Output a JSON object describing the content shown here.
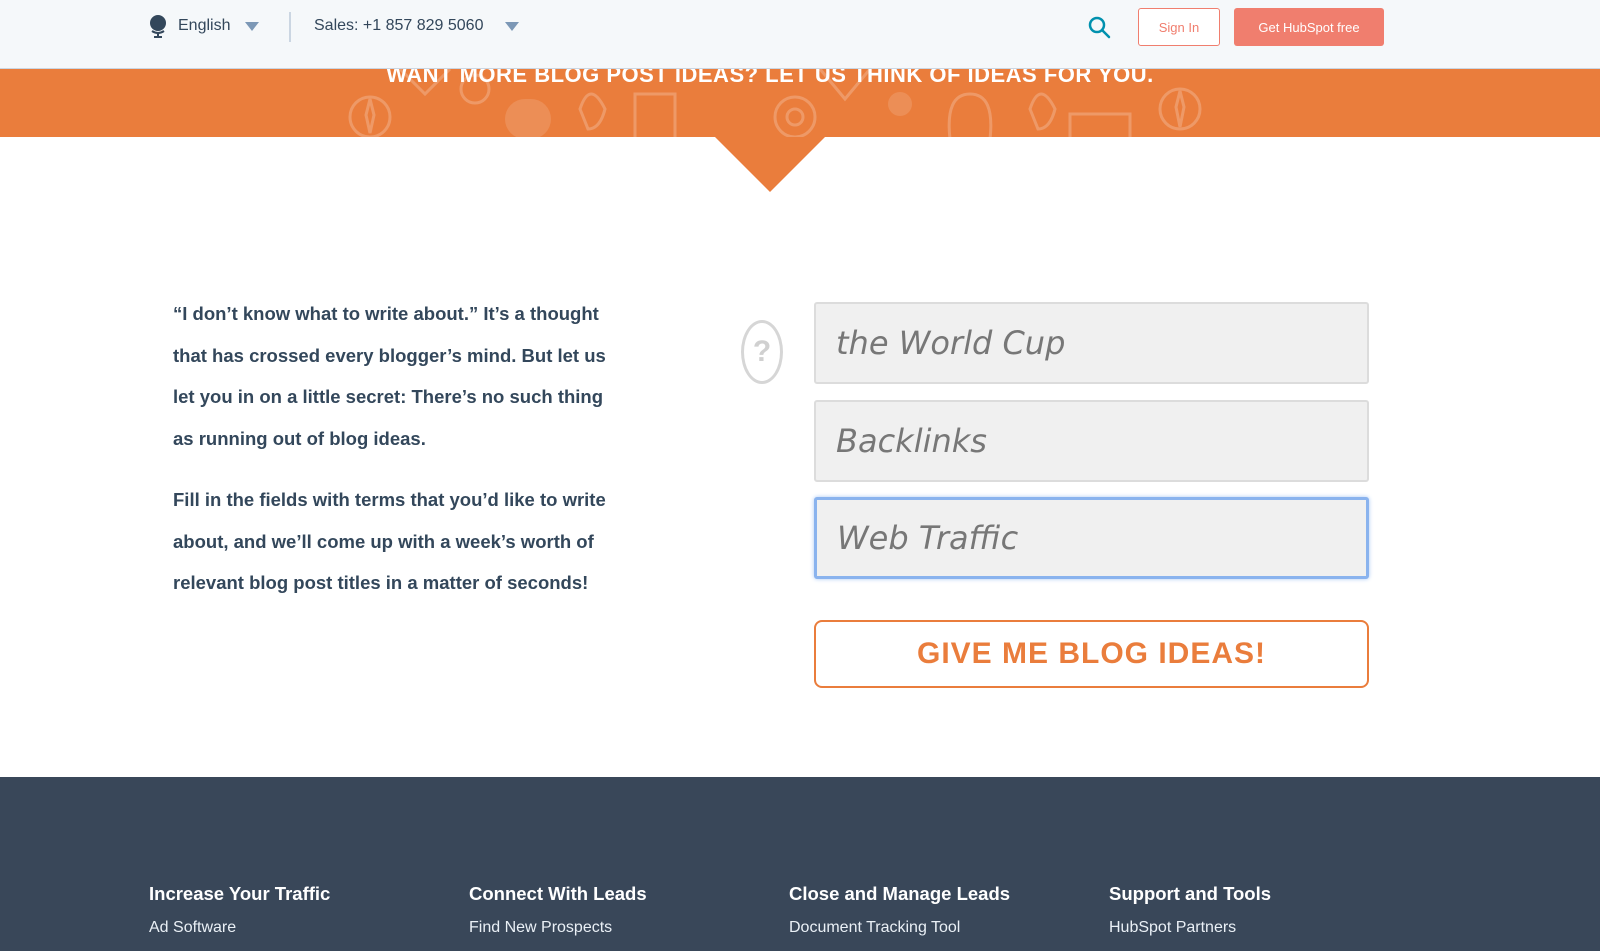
{
  "nav": {
    "language": "English",
    "sales": "Sales: +1 857 829 5060",
    "sign_in": "Sign In",
    "get_free": "Get HubSpot free"
  },
  "banner": {
    "title": "WANT MORE BLOG POST IDEAS? LET US THINK OF IDEAS FOR YOU."
  },
  "intro": {
    "paragraph1": "“I don’t know what to write about.” It’s a thought that has crossed every blogger’s mind. But let us let you in on a little secret: There’s no such thing as running out of blog ideas.",
    "paragraph2": "Fill in the fields with terms that you’d like to write about, and we’ll come up with a week’s worth of relevant blog post titles in a matter of seconds!"
  },
  "form": {
    "help_symbol": "?",
    "field1": "the World Cup",
    "field2": "Backlinks",
    "field3": "Web Traffic",
    "submit": "GIVE ME BLOG IDEAS!"
  },
  "footer": {
    "columns": [
      {
        "heading": "Increase Your Traffic",
        "first_link": "Ad Software"
      },
      {
        "heading": "Connect With Leads",
        "first_link": "Find New Prospects"
      },
      {
        "heading": "Close and Manage Leads",
        "first_link": "Document Tracking Tool"
      },
      {
        "heading": "Support and Tools",
        "first_link": "HubSpot Partners"
      }
    ]
  },
  "colors": {
    "accent_orange": "#ea7d3c",
    "cta_coral": "#f07e6e",
    "footer_bg": "#394759",
    "text": "#33475b"
  }
}
